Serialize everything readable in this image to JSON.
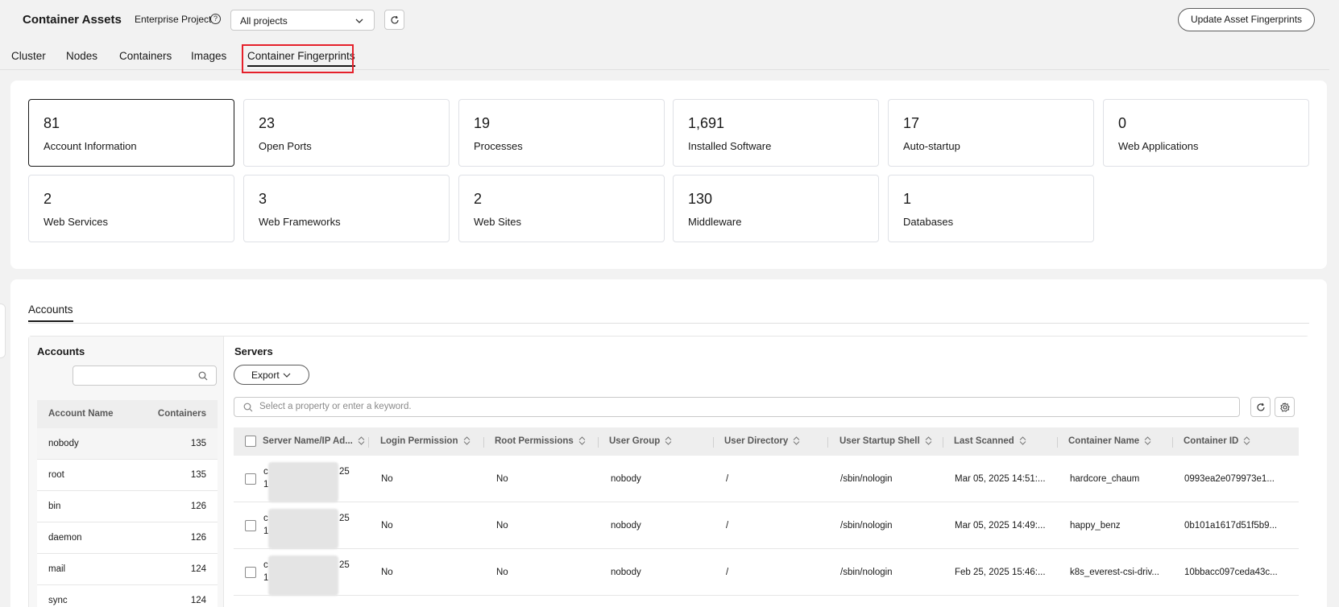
{
  "header": {
    "title": "Container Assets",
    "enterprise_project_label": "Enterprise Project",
    "project_select_value": "All projects",
    "update_button": "Update Asset Fingerprints"
  },
  "tabs": [
    {
      "label": "Cluster"
    },
    {
      "label": "Nodes"
    },
    {
      "label": "Containers"
    },
    {
      "label": "Images"
    },
    {
      "label": "Container Fingerprints",
      "active": true
    }
  ],
  "stats": [
    {
      "value": "81",
      "label": "Account Information",
      "selected": true
    },
    {
      "value": "23",
      "label": "Open Ports"
    },
    {
      "value": "19",
      "label": "Processes"
    },
    {
      "value": "1,691",
      "label": "Installed Software"
    },
    {
      "value": "17",
      "label": "Auto-startup"
    },
    {
      "value": "0",
      "label": "Web Applications"
    },
    {
      "value": "2",
      "label": "Web Services"
    },
    {
      "value": "3",
      "label": "Web Frameworks"
    },
    {
      "value": "2",
      "label": "Web Sites"
    },
    {
      "value": "130",
      "label": "Middleware"
    },
    {
      "value": "1",
      "label": "Databases"
    }
  ],
  "accounts_section": {
    "sub_tab": "Accounts",
    "left_title": "Accounts",
    "search_value": "",
    "columns": [
      "Account Name",
      "Containers"
    ],
    "rows": [
      {
        "name": "nobody",
        "count": "135"
      },
      {
        "name": "root",
        "count": "135"
      },
      {
        "name": "bin",
        "count": "126"
      },
      {
        "name": "daemon",
        "count": "126"
      },
      {
        "name": "mail",
        "count": "124"
      },
      {
        "name": "sync",
        "count": "124"
      }
    ]
  },
  "servers_section": {
    "title": "Servers",
    "export_label": "Export",
    "search_placeholder": "Select a property or enter a keyword.",
    "columns": [
      "Server Name/IP Ad...",
      "Login Permission",
      "Root Permissions",
      "User Group",
      "User Directory",
      "User Startup Shell",
      "Last Scanned",
      "Container Name",
      "Container ID"
    ],
    "rows": [
      {
        "server_line1": "c",
        "server_line1_tail": "25",
        "server_line2": "1",
        "login": "No",
        "root": "No",
        "group": "nobody",
        "dir": "/",
        "shell": "/sbin/nologin",
        "scanned": "Mar 05, 2025 14:51:...",
        "container_name": "hardcore_chaum",
        "container_id": "0993ea2e079973e1..."
      },
      {
        "server_line1": "c",
        "server_line1_tail": "25",
        "server_line2": "1",
        "login": "No",
        "root": "No",
        "group": "nobody",
        "dir": "/",
        "shell": "/sbin/nologin",
        "scanned": "Mar 05, 2025 14:49:...",
        "container_name": "happy_benz",
        "container_id": "0b101a1617d51f5b9..."
      },
      {
        "server_line1": "c",
        "server_line1_tail": "25",
        "server_line2": "1",
        "login": "No",
        "root": "No",
        "group": "nobody",
        "dir": "/",
        "shell": "/sbin/nologin",
        "scanned": "Feb 25, 2025 15:46:...",
        "container_name": "k8s_everest-csi-driv...",
        "container_id": "10bbacc097ceda43c..."
      }
    ]
  }
}
